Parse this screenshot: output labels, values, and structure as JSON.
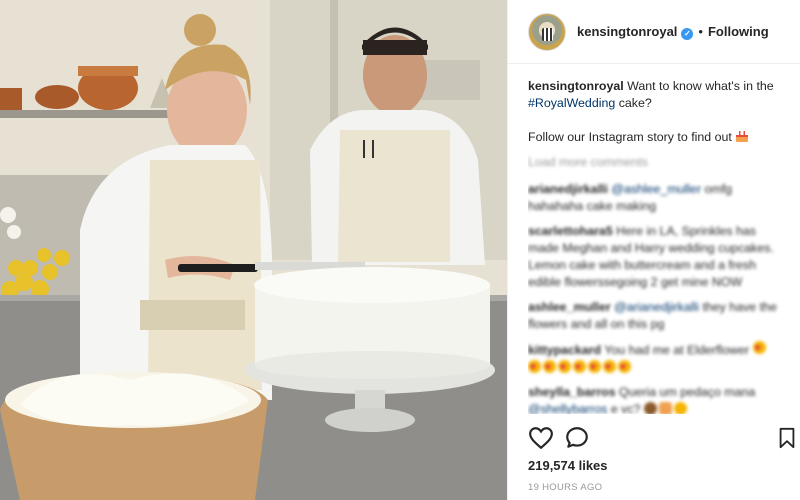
{
  "post": {
    "photo_alt": "",
    "header": {
      "username": "kensingtonroyal",
      "separator": "•",
      "follow_state": "Following",
      "verified_icon": "verified-badge-icon"
    },
    "caption": {
      "username": "kensingtonroyal",
      "text_before": " Want to know what's in the ",
      "hashtag": "#RoyalWedding",
      "text_after": " cake?",
      "follow_line": "Follow our Instagram story to find out",
      "emoji_icon": "birthday-cake-emoji"
    },
    "load_more": "Load more comments",
    "comments": [
      {
        "username": "arianedjirkalli",
        "mention": "@ashlee_muller",
        "text": " omfg hahahaha cake making"
      },
      {
        "username": "scarlettohara5",
        "mention": "",
        "text": " Here in LA, Sprinkles has made Meghan and Harry wedding cupcakes. Lemon cake with buttercream and a fresh edible flowerssegoing 2 get mine NOW"
      },
      {
        "username": "ashlee_muller",
        "mention": "@arianedjirkalli",
        "text": " they have the flowers and all on this pg"
      },
      {
        "username": "kittypackard",
        "mention": "",
        "text": " You had me at Elderflower"
      },
      {
        "username": "sheylla_barros",
        "mention": "",
        "text": " Queria um pedaço mana"
      },
      {
        "username": "",
        "mention": "@shellybarros",
        "text": " e vc?"
      }
    ],
    "actions": {
      "like_icon": "heart-icon",
      "comment_icon": "comment-icon",
      "save_icon": "bookmark-icon"
    },
    "likes": "219,574 likes",
    "time": "19 HOURS AGO",
    "colors": {
      "link": "#003569",
      "verified": "#3897f0",
      "muted": "#999999",
      "text": "#262626"
    }
  }
}
